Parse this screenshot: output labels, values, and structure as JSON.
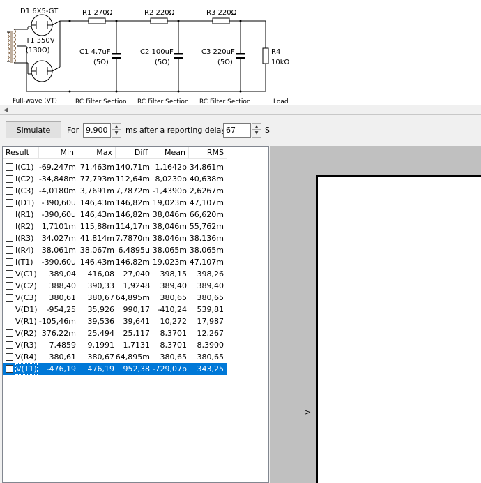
{
  "schematic": {
    "labels": {
      "d1": "D1 6X5-GT",
      "r1": "R1 270Ω",
      "r2": "R2 220Ω",
      "r3": "R3 220Ω",
      "t1_name": "T1 350V",
      "t1_res": "(130Ω)",
      "c1_name": "C1 4,7uF",
      "c1_res": "(5Ω)",
      "c2_name": "C2 100uF",
      "c2_res": "(5Ω)",
      "c3_name": "C3 220uF",
      "c3_res": "(5Ω)",
      "r4_name": "R4",
      "r4_val": "10kΩ"
    },
    "sections": [
      "Full-wave (VT)",
      "RC Filter Section",
      "RC Filter Section",
      "RC Filter Section",
      "Load"
    ]
  },
  "toolbar": {
    "simulate_label": "Simulate",
    "for_label": "For",
    "duration_value": "9.900",
    "ms_label": "ms  after a reporting delay of",
    "delay_value": "67",
    "s_label": "S"
  },
  "table": {
    "columns": [
      "Result",
      "Min",
      "Max",
      "Diff",
      "Mean",
      "RMS"
    ],
    "selected_index": 17,
    "rows": [
      {
        "name": "I(C1)",
        "min": "-69,247m",
        "max": "71,463m",
        "diff": "140,71m",
        "mean": "1,1642p",
        "rms": "34,861m"
      },
      {
        "name": "I(C2)",
        "min": "-34,848m",
        "max": "77,793m",
        "diff": "112,64m",
        "mean": "8,0230p",
        "rms": "40,638m"
      },
      {
        "name": "I(C3)",
        "min": "-4,0180m",
        "max": "3,7691m",
        "diff": "7,7872m",
        "mean": "-1,4390p",
        "rms": "2,6267m"
      },
      {
        "name": "I(D1)",
        "min": "-390,60u",
        "max": "146,43m",
        "diff": "146,82m",
        "mean": "19,023m",
        "rms": "47,107m"
      },
      {
        "name": "I(R1)",
        "min": "-390,60u",
        "max": "146,43m",
        "diff": "146,82m",
        "mean": "38,046m",
        "rms": "66,620m"
      },
      {
        "name": "I(R2)",
        "min": "1,7101m",
        "max": "115,88m",
        "diff": "114,17m",
        "mean": "38,046m",
        "rms": "55,762m"
      },
      {
        "name": "I(R3)",
        "min": "34,027m",
        "max": "41,814m",
        "diff": "7,7870m",
        "mean": "38,046m",
        "rms": "38,136m"
      },
      {
        "name": "I(R4)",
        "min": "38,061m",
        "max": "38,067m",
        "diff": "6,4895u",
        "mean": "38,065m",
        "rms": "38,065m"
      },
      {
        "name": "I(T1)",
        "min": "-390,60u",
        "max": "146,43m",
        "diff": "146,82m",
        "mean": "19,023m",
        "rms": "47,107m"
      },
      {
        "name": "V(C1)",
        "min": "389,04",
        "max": "416,08",
        "diff": "27,040",
        "mean": "398,15",
        "rms": "398,26"
      },
      {
        "name": "V(C2)",
        "min": "388,40",
        "max": "390,33",
        "diff": "1,9248",
        "mean": "389,40",
        "rms": "389,40"
      },
      {
        "name": "V(C3)",
        "min": "380,61",
        "max": "380,67",
        "diff": "64,895m",
        "mean": "380,65",
        "rms": "380,65"
      },
      {
        "name": "V(D1)",
        "min": "-954,25",
        "max": "35,926",
        "diff": "990,17",
        "mean": "-410,24",
        "rms": "539,81"
      },
      {
        "name": "V(R1)",
        "min": "-105,46m",
        "max": "39,536",
        "diff": "39,641",
        "mean": "10,272",
        "rms": "17,987"
      },
      {
        "name": "V(R2)",
        "min": "376,22m",
        "max": "25,494",
        "diff": "25,117",
        "mean": "8,3701",
        "rms": "12,267"
      },
      {
        "name": "V(R3)",
        "min": "7,4859",
        "max": "9,1991",
        "diff": "1,7131",
        "mean": "8,3701",
        "rms": "8,3900"
      },
      {
        "name": "V(R4)",
        "min": "380,61",
        "max": "380,67",
        "diff": "64,895m",
        "mean": "380,65",
        "rms": "380,65"
      },
      {
        "name": "V(T1)",
        "min": "-476,19",
        "max": "476,19",
        "diff": "952,38",
        "mean": "-729,07p",
        "rms": "343,25"
      }
    ]
  },
  "graph": {
    "arrow": ">"
  }
}
